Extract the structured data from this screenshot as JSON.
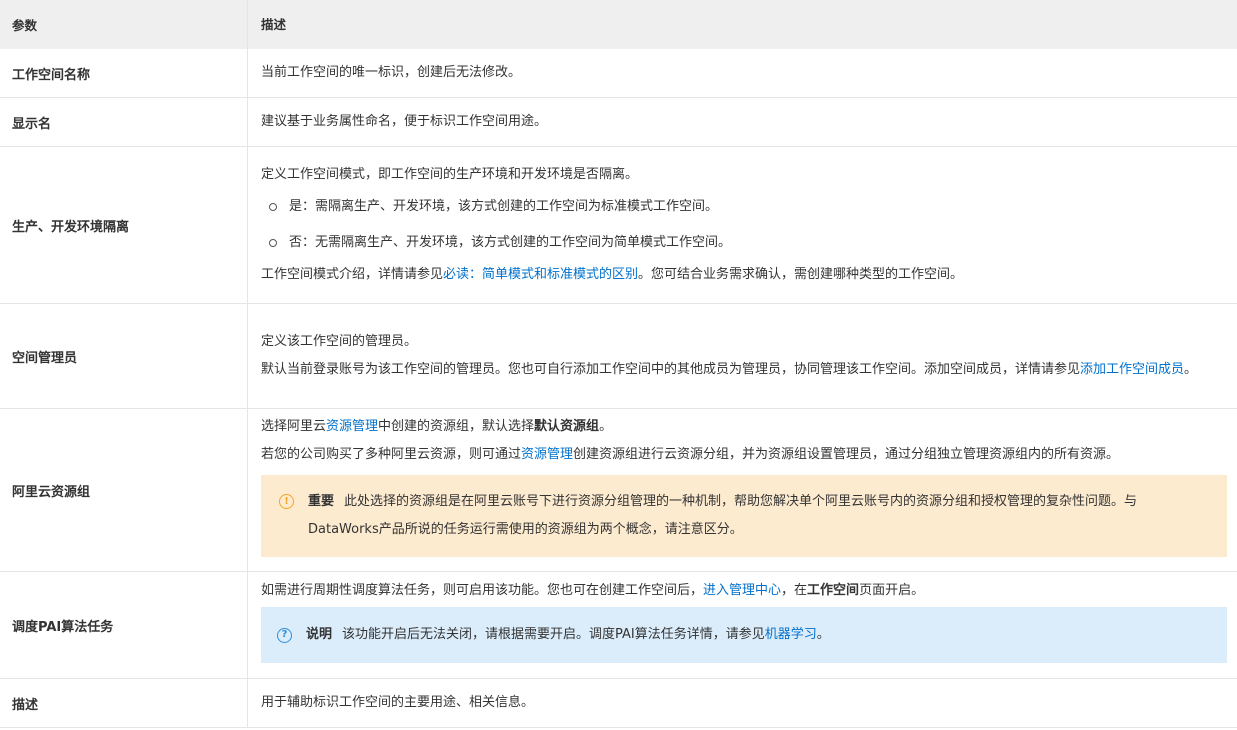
{
  "header": {
    "param": "参数",
    "desc": "描述"
  },
  "rows": [
    {
      "name": "工作空间名称",
      "text": "当前工作空间的唯一标识，创建后无法修改。"
    },
    {
      "name": "显示名",
      "text": "建议基于业务属性命名，便于标识工作空间用途。"
    },
    {
      "name": "生产、开发环境隔离",
      "intro": "定义工作空间模式，即工作空间的生产环境和开发环境是否隔离。",
      "options": [
        "是：需隔离生产、开发环境，该方式创建的工作空间为标准模式工作空间。",
        "否：无需隔离生产、开发环境，该方式创建的工作空间为简单模式工作空间。"
      ],
      "outro_pre": "工作空间模式介绍，详情请参见",
      "outro_link": "必读：简单模式和标准模式的区别",
      "outro_post": "。您可结合业务需求确认，需创建哪种类型的工作空间。"
    },
    {
      "name": "空间管理员",
      "line1": "定义该工作空间的管理员。",
      "line2_pre": "默认当前登录账号为该工作空间的管理员。您也可自行添加工作空间中的其他成员为管理员，协同管理该工作空间。添加空间成员，详情请参见",
      "line2_link": "添加工作空间成员",
      "line2_post": "。"
    },
    {
      "name": "阿里云资源组",
      "l1_pre": "选择阿里云",
      "l1_link": "资源管理",
      "l1_mid": "中创建的资源组，默认选择",
      "l1_bold": "默认资源组",
      "l1_post": "。",
      "l2_pre": "若您的公司购买了多种阿里云资源，则可通过",
      "l2_link": "资源管理",
      "l2_post": "创建资源组进行云资源分组，并为资源组设置管理员，通过分组独立管理资源组内的所有资源。",
      "callout_icon": "warning-icon",
      "callout_title": "重要",
      "callout_text": "此处选择的资源组是在阿里云账号下进行资源分组管理的一种机制，帮助您解决单个阿里云账号内的资源分组和授权管理的复杂性问题。与DataWorks产品所说的任务运行需使用的资源组为两个概念，请注意区分。"
    },
    {
      "name": "调度PAI算法任务",
      "l1_pre": "如需进行周期性调度算法任务，则可启用该功能。您也可在创建工作空间后，",
      "l1_link": "进入管理中心",
      "l1_mid": "，在",
      "l1_bold": "工作空间",
      "l1_post": "页面开启。",
      "callout_icon": "question-icon",
      "callout_title": "说明",
      "callout_pre": "该功能开启后无法关闭，请根据需要开启。调度PAI算法任务详情，请参见",
      "callout_link": "机器学习",
      "callout_post": "。"
    },
    {
      "name": "描述",
      "text": "用于辅助标识工作空间的主要用途、相关信息。"
    }
  ],
  "colors": {
    "header_bg": "#efefef",
    "link": "#0070cc",
    "warn_bg": "#fdebd0",
    "note_bg": "#dbedfb"
  }
}
